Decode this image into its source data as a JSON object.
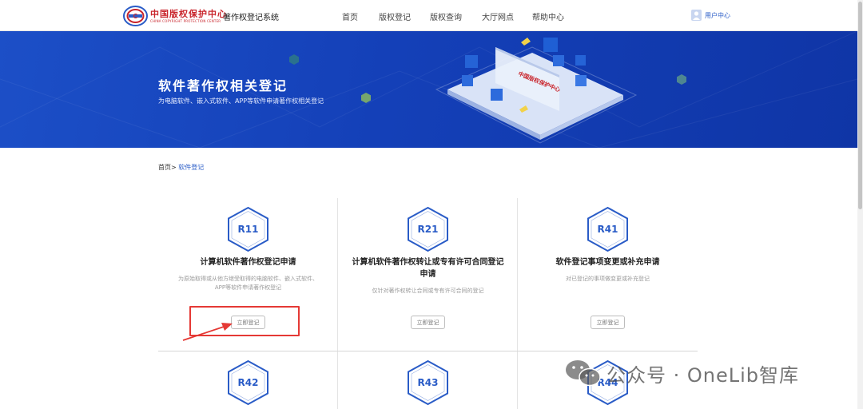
{
  "header": {
    "logo_cn": "中国版权保护中心",
    "logo_en": "CHINA COPYRIGHT PROTECTION CENTER",
    "system_name": "著作权登记系统",
    "nav": [
      "首页",
      "版权登记",
      "版权查询",
      "大厅网点",
      "帮助中心"
    ],
    "user_label": "用户中心"
  },
  "banner": {
    "title": "软件著作权相关登记",
    "subtitle": "为电脑软件、嵌入式软件、APP等软件申请著作权相关登记",
    "art_logo_text": "中国版权保护中心"
  },
  "breadcrumb": {
    "home": "首页",
    "separator": ">",
    "current": "软件登记"
  },
  "cards": [
    {
      "code": "R11",
      "title": "计算机软件著作权登记申请",
      "desc": "为原始取得或从他方继受取得的电脑软件、嵌入式软件、APP等软件申请著作权登记",
      "button": "立即登记"
    },
    {
      "code": "R21",
      "title": "计算机软件著作权转让或专有许可合同登记申请",
      "desc": "仅针对著作权转让合同或专有许可合同的登记",
      "button": "立即登记"
    },
    {
      "code": "R41",
      "title": "软件登记事项变更或补充申请",
      "desc": "对已登记的事项做变更或补充登记",
      "button": "立即登记"
    }
  ],
  "cards_row2": [
    {
      "code": "R42"
    },
    {
      "code": "R43"
    },
    {
      "code": "R44"
    }
  ],
  "watermark": "公众号 · OneLib智库",
  "colors": {
    "brand_blue": "#2a5cc7",
    "banner_blue": "#1440b8",
    "logo_red": "#c9252c",
    "annotation_red": "#e53935"
  }
}
